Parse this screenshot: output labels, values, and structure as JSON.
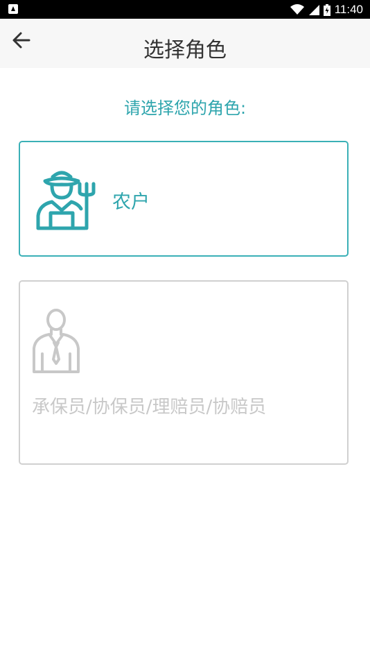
{
  "status_bar": {
    "time": "11:40",
    "icons": [
      "app-notification-icon",
      "wifi-icon",
      "cellular-signal-icon",
      "battery-icon"
    ]
  },
  "app_bar": {
    "back_icon": "arrow-left-icon",
    "title": "选择角色"
  },
  "prompt": "请选择您的角色:",
  "roles": [
    {
      "label": "农户",
      "icon": "farmer-icon",
      "selected": true
    },
    {
      "label": "承保员/协保员/理赔员/协赔员",
      "icon": "staff-person-icon",
      "selected": false
    }
  ],
  "colors": {
    "accent": "#2ea5ad",
    "accent_border": "#3ab0b6",
    "inactive": "#c8c8c8",
    "title": "#333333",
    "app_bar_bg": "#f7f7f7"
  }
}
